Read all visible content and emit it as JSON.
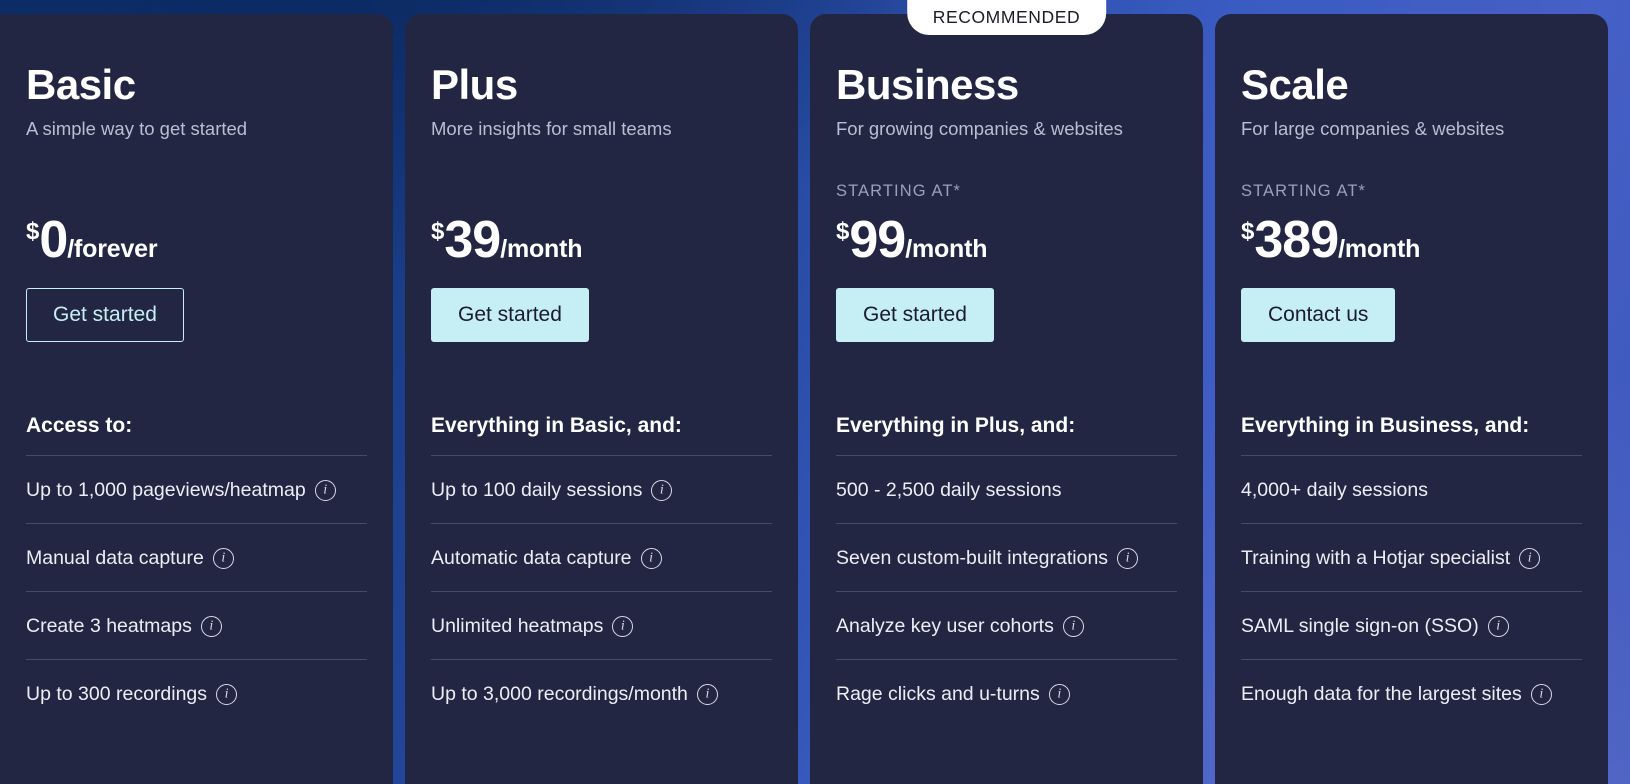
{
  "colors": {
    "card_bg": "#232642",
    "accent_button": "#c5eff5",
    "badge_bg": "#ffffff",
    "text_primary": "#ffffff",
    "text_muted": "#b9bed2",
    "divider": "#474a63",
    "background_blue": "#3a5bc2"
  },
  "badge": {
    "label": "RECOMMENDED"
  },
  "plans": [
    {
      "name": "Basic",
      "tagline": "A simple way to get started",
      "starting_at": "",
      "currency": "$",
      "amount": "0",
      "period": "/forever",
      "cta_label": "Get started",
      "cta_style": "outline",
      "features_title": "Access to:",
      "features": [
        {
          "text": "Up to 1,000 pageviews/heatmap",
          "info": true
        },
        {
          "text": "Manual data capture",
          "info": true
        },
        {
          "text": "Create 3 heatmaps",
          "info": true
        },
        {
          "text": "Up to 300 recordings",
          "info": true
        }
      ]
    },
    {
      "name": "Plus",
      "tagline": "More insights for small teams",
      "starting_at": "",
      "currency": "$",
      "amount": "39",
      "period": "/month",
      "cta_label": "Get started",
      "cta_style": "filled",
      "features_title": "Everything in Basic, and:",
      "features": [
        {
          "text": "Up to 100 daily sessions",
          "info": true
        },
        {
          "text": "Automatic data capture",
          "info": true
        },
        {
          "text": "Unlimited heatmaps",
          "info": true
        },
        {
          "text": "Up to 3,000 recordings/month",
          "info": true
        }
      ]
    },
    {
      "name": "Business",
      "tagline": "For growing companies & websites",
      "starting_at": "STARTING AT*",
      "currency": "$",
      "amount": "99",
      "period": "/month",
      "cta_label": "Get started",
      "cta_style": "filled",
      "features_title": "Everything in Plus, and:",
      "recommended": true,
      "features": [
        {
          "text": "500 - 2,500 daily sessions",
          "info": false
        },
        {
          "text": "Seven custom-built integrations",
          "info": true
        },
        {
          "text": "Analyze key user cohorts",
          "info": true
        },
        {
          "text": "Rage clicks and u-turns",
          "info": true
        }
      ]
    },
    {
      "name": "Scale",
      "tagline": "For large companies & websites",
      "starting_at": "STARTING AT*",
      "currency": "$",
      "amount": "389",
      "period": "/month",
      "cta_label": "Contact us",
      "cta_style": "filled",
      "features_title": "Everything in Business, and:",
      "features": [
        {
          "text": "4,000+ daily sessions",
          "info": false
        },
        {
          "text": "Training with a Hotjar specialist",
          "info": true
        },
        {
          "text": "SAML single sign-on (SSO)",
          "info": true
        },
        {
          "text": "Enough data for the largest sites",
          "info": true
        }
      ]
    }
  ],
  "icons": {
    "info": "info-icon"
  }
}
